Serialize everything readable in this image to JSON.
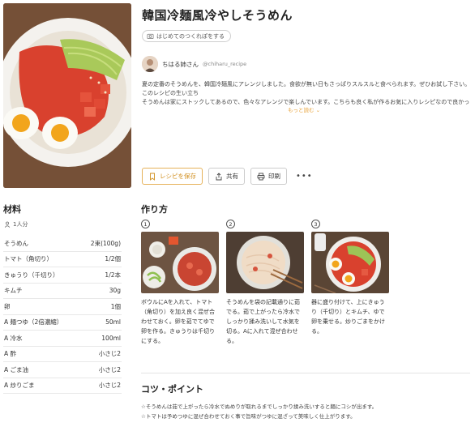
{
  "recipe": {
    "title": "韓国冷麺風冷やしそうめん",
    "first_time_label": "はじめてのつくれぽをする",
    "author_name": "ちはる姉さん",
    "author_id": "@chiharu_recipe",
    "description": [
      "夏の定番のそうめんを、韓国冷麺風にアレンジしました。食欲が無い日もさっぱりスルスルと食べられます。ぜひお試し下さい。",
      "このレシピの生い立ち",
      "そうめんは家にストックしてあるので、色々なアレンジで楽しんでいます。こちらも良く私が作るお気に入りレシピなので良かった..."
    ],
    "more_label": "もっと読む",
    "actions": {
      "save": "レシピを保存",
      "share": "共有",
      "print": "印刷",
      "more": "•••"
    }
  },
  "ingredients_section": {
    "title": "材料",
    "servings": "1人分",
    "items": [
      {
        "name": "そうめん",
        "amount": "2束(100g)"
      },
      {
        "name": "トマト（角切り）",
        "amount": "1/2個"
      },
      {
        "name": "きゅうり（千切り）",
        "amount": "1/2本"
      },
      {
        "name": "キムチ",
        "amount": "30g"
      },
      {
        "name": "卵",
        "amount": "1個"
      },
      {
        "name": "A 麺つゆ（2倍濃縮）",
        "amount": "50ml"
      },
      {
        "name": "A 冷水",
        "amount": "100ml"
      },
      {
        "name": "A 酢",
        "amount": "小さじ2"
      },
      {
        "name": "A ごま油",
        "amount": "小さじ2"
      },
      {
        "name": "A 炒りごま",
        "amount": "小さじ2"
      }
    ]
  },
  "steps_section": {
    "title": "作り方",
    "steps": [
      {
        "num": "1",
        "text": "ボウルにAを入れて、トマト（角切り）を加え良く混ぜ合わせておく。卵を茹でてゆで卵を作る。きゅうりは千切りにする。"
      },
      {
        "num": "2",
        "text": "そうめんを袋の記載通りに茹でる。茹で上がったら冷水でしっかり揉み洗いして水気を切る。Aに入れて混ぜ合わせる。"
      },
      {
        "num": "3",
        "text": "器に盛り付けて、上にきゅうり（千切り）とキムチ、ゆで卵を乗せる。炒りごまをかける。"
      }
    ]
  },
  "tips_section": {
    "title": "コツ・ポイント",
    "lines": [
      "☆そうめんは茹で上がったら冷水でぬめりが取れるまでしっかり揉み洗いすると麺にコシが出ます。",
      "☆トマトは予めつゆに混ぜ合わせておく事で旨味がつゆに混ざって美味しく仕上がります。"
    ]
  },
  "colors": {
    "accent": "#e8a33a"
  }
}
